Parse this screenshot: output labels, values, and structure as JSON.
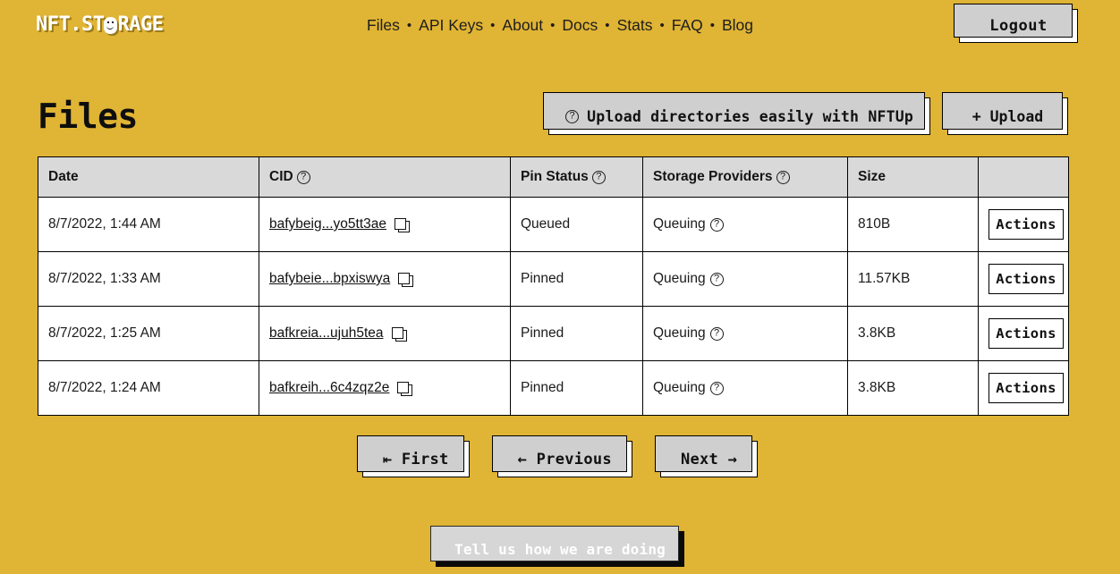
{
  "brand": {
    "name_part1": "NFT.ST",
    "name_part2": "RAGE",
    "logo_alt": "NFT.STORAGE"
  },
  "nav": {
    "separator": "•",
    "items": [
      {
        "label": "Files"
      },
      {
        "label": "API Keys"
      },
      {
        "label": "About"
      },
      {
        "label": "Docs"
      },
      {
        "label": "Stats"
      },
      {
        "label": "FAQ"
      },
      {
        "label": "Blog"
      }
    ],
    "logout_label": "Logout"
  },
  "page": {
    "title": "Files",
    "nftup_button_label": "Upload directories easily with NFTUp",
    "upload_button_label": "+ Upload"
  },
  "table": {
    "columns": [
      {
        "key": "date",
        "label": "Date",
        "help": false
      },
      {
        "key": "cid",
        "label": "CID",
        "help": true
      },
      {
        "key": "pin",
        "label": "Pin Status",
        "help": true
      },
      {
        "key": "sp",
        "label": "Storage Providers",
        "help": true
      },
      {
        "key": "size",
        "label": "Size",
        "help": false
      },
      {
        "key": "actions",
        "label": "",
        "help": false
      }
    ],
    "rows": [
      {
        "date": "8/7/2022, 1:44 AM",
        "cid": "bafybeig...yo5tt3ae",
        "pin_status": "Queued",
        "storage_provider": "Queuing",
        "size": "810B",
        "actions_label": "Actions"
      },
      {
        "date": "8/7/2022, 1:33 AM",
        "cid": "bafybeie...bpxiswya",
        "pin_status": "Pinned",
        "storage_provider": "Queuing",
        "size": "11.57KB",
        "actions_label": "Actions"
      },
      {
        "date": "8/7/2022, 1:25 AM",
        "cid": "bafkreia...ujuh5tea",
        "pin_status": "Pinned",
        "storage_provider": "Queuing",
        "size": "3.8KB",
        "actions_label": "Actions"
      },
      {
        "date": "8/7/2022, 1:24 AM",
        "cid": "bafkreih...6c4zqz2e",
        "pin_status": "Pinned",
        "storage_provider": "Queuing",
        "size": "3.8KB",
        "actions_label": "Actions"
      }
    ]
  },
  "pagination": {
    "first_label": "⇤ First",
    "previous_label": "← Previous",
    "next_label": "Next →"
  },
  "feedback": {
    "label": "Tell us how we are doing"
  },
  "colors": {
    "background": "#e0b434",
    "surface": "#ffffff",
    "table_header": "#d9d9d9",
    "border": "#000000",
    "shadow_layer": "#cfcfcf",
    "feedback_bg": "#0a0a0a",
    "text": "#1a1a1a"
  }
}
